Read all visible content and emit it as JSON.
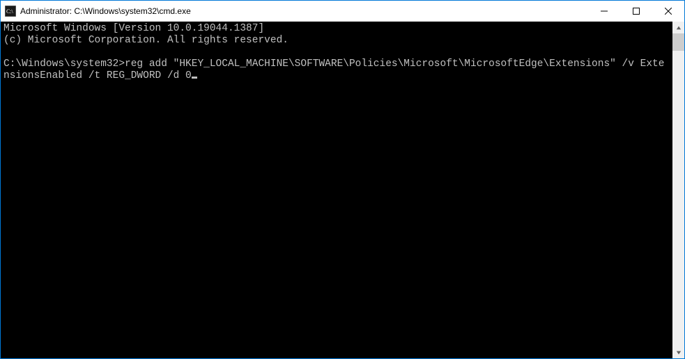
{
  "titlebar": {
    "title": "Administrator: C:\\Windows\\system32\\cmd.exe"
  },
  "terminal": {
    "banner_line1": "Microsoft Windows [Version 10.0.19044.1387]",
    "banner_line2": "(c) Microsoft Corporation. All rights reserved.",
    "prompt": "C:\\Windows\\system32>",
    "command": "reg add \"HKEY_LOCAL_MACHINE\\SOFTWARE\\Policies\\Microsoft\\MicrosoftEdge\\Extensions\" /v ExtensionsEnabled /t REG_DWORD /d 0"
  }
}
